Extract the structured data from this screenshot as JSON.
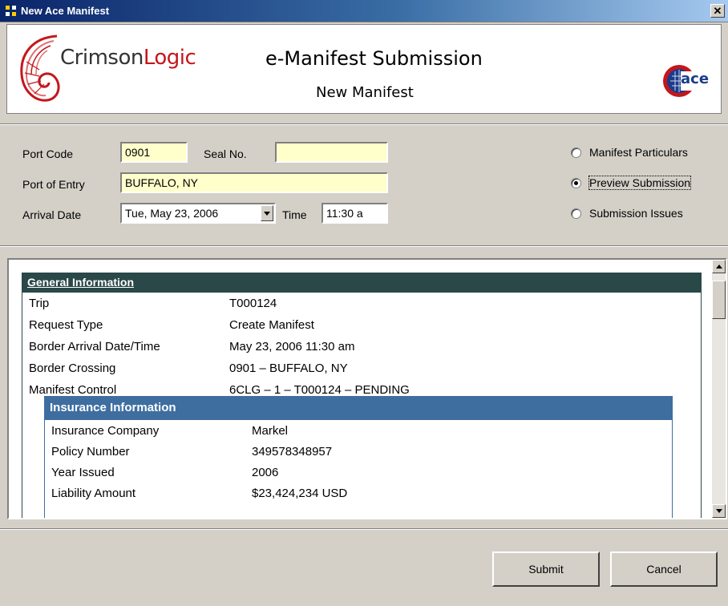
{
  "window": {
    "title": "New Ace Manifest",
    "close_glyph": "✕"
  },
  "header": {
    "brand_part1": "Crimson",
    "brand_part2": "Logic",
    "title": "e-Manifest Submission",
    "subtitle": "New Manifest",
    "ace_logo_text": "ace"
  },
  "form": {
    "port_code_label": "Port Code",
    "port_code_value": "0901",
    "seal_label": "Seal No.",
    "seal_value": "",
    "port_entry_label": "Port of Entry",
    "port_entry_value": "BUFFALO, NY",
    "arrival_label": "Arrival Date",
    "arrival_value": "Tue, May 23, 2006",
    "time_label": "Time",
    "time_value": "11:30 a"
  },
  "view_options": {
    "selected": "preview",
    "items": [
      {
        "id": "particulars",
        "label": "Manifest Particulars"
      },
      {
        "id": "preview",
        "label": "Preview Submission"
      },
      {
        "id": "issues",
        "label": "Submission Issues"
      }
    ]
  },
  "general_info": {
    "heading": "General Information",
    "rows": [
      {
        "key": "Trip",
        "value": "T000124"
      },
      {
        "key": "Request Type",
        "value": "Create Manifest"
      },
      {
        "key": "Border Arrival Date/Time",
        "value": "May 23, 2006 11:30 am"
      },
      {
        "key": "Border Crossing",
        "value": "0901 – BUFFALO, NY"
      },
      {
        "key": "Manifest Control",
        "value": "6CLG – 1 – T000124 – PENDING"
      }
    ]
  },
  "insurance_info": {
    "heading": "Insurance Information",
    "rows": [
      {
        "key": "Insurance Company",
        "value": "Markel"
      },
      {
        "key": "Policy Number",
        "value": "349578348957"
      },
      {
        "key": "Year Issued",
        "value": "2006"
      },
      {
        "key": "Liability Amount",
        "value": "$23,424,234 USD"
      }
    ]
  },
  "buttons": {
    "submit": "Submit",
    "cancel": "Cancel"
  },
  "colors": {
    "section_header": "#2a4848",
    "insurance_header": "#3e6ea0",
    "field_bg": "#ffffcc",
    "brand_red": "#c4161c"
  }
}
